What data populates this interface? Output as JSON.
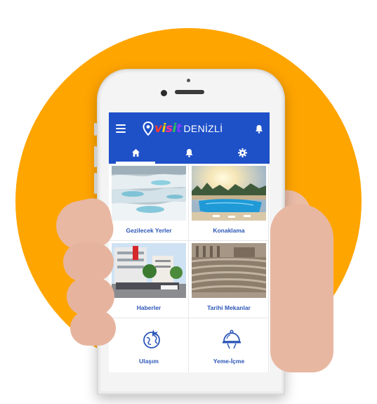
{
  "app": {
    "logo_visit": "visit",
    "logo_city": "DENİZLİ"
  },
  "icons": {
    "menu": "menu-icon",
    "location": "location-pin-icon",
    "notifications": "bell-icon",
    "home": "home-icon",
    "settings": "gear-icon",
    "transport": "globe-plane-icon",
    "food": "food-cloche-icon"
  },
  "tabs": [
    {
      "name": "home",
      "icon": "home-icon",
      "active": true
    },
    {
      "name": "notifications",
      "icon": "bell-icon",
      "active": false
    },
    {
      "name": "settings",
      "icon": "gear-icon",
      "active": false
    }
  ],
  "tiles": [
    {
      "label": "Gezilecek Yerler"
    },
    {
      "label": "Konaklama"
    },
    {
      "label": "Haberler"
    },
    {
      "label": "Tarihi Mekanlar"
    },
    {
      "label": "Ulaşım"
    },
    {
      "label": "Yeme-İçme"
    }
  ],
  "colors": {
    "brand_blue": "#1E50C8",
    "label_blue": "#2C56B8",
    "background_circle": "#FFA500"
  }
}
